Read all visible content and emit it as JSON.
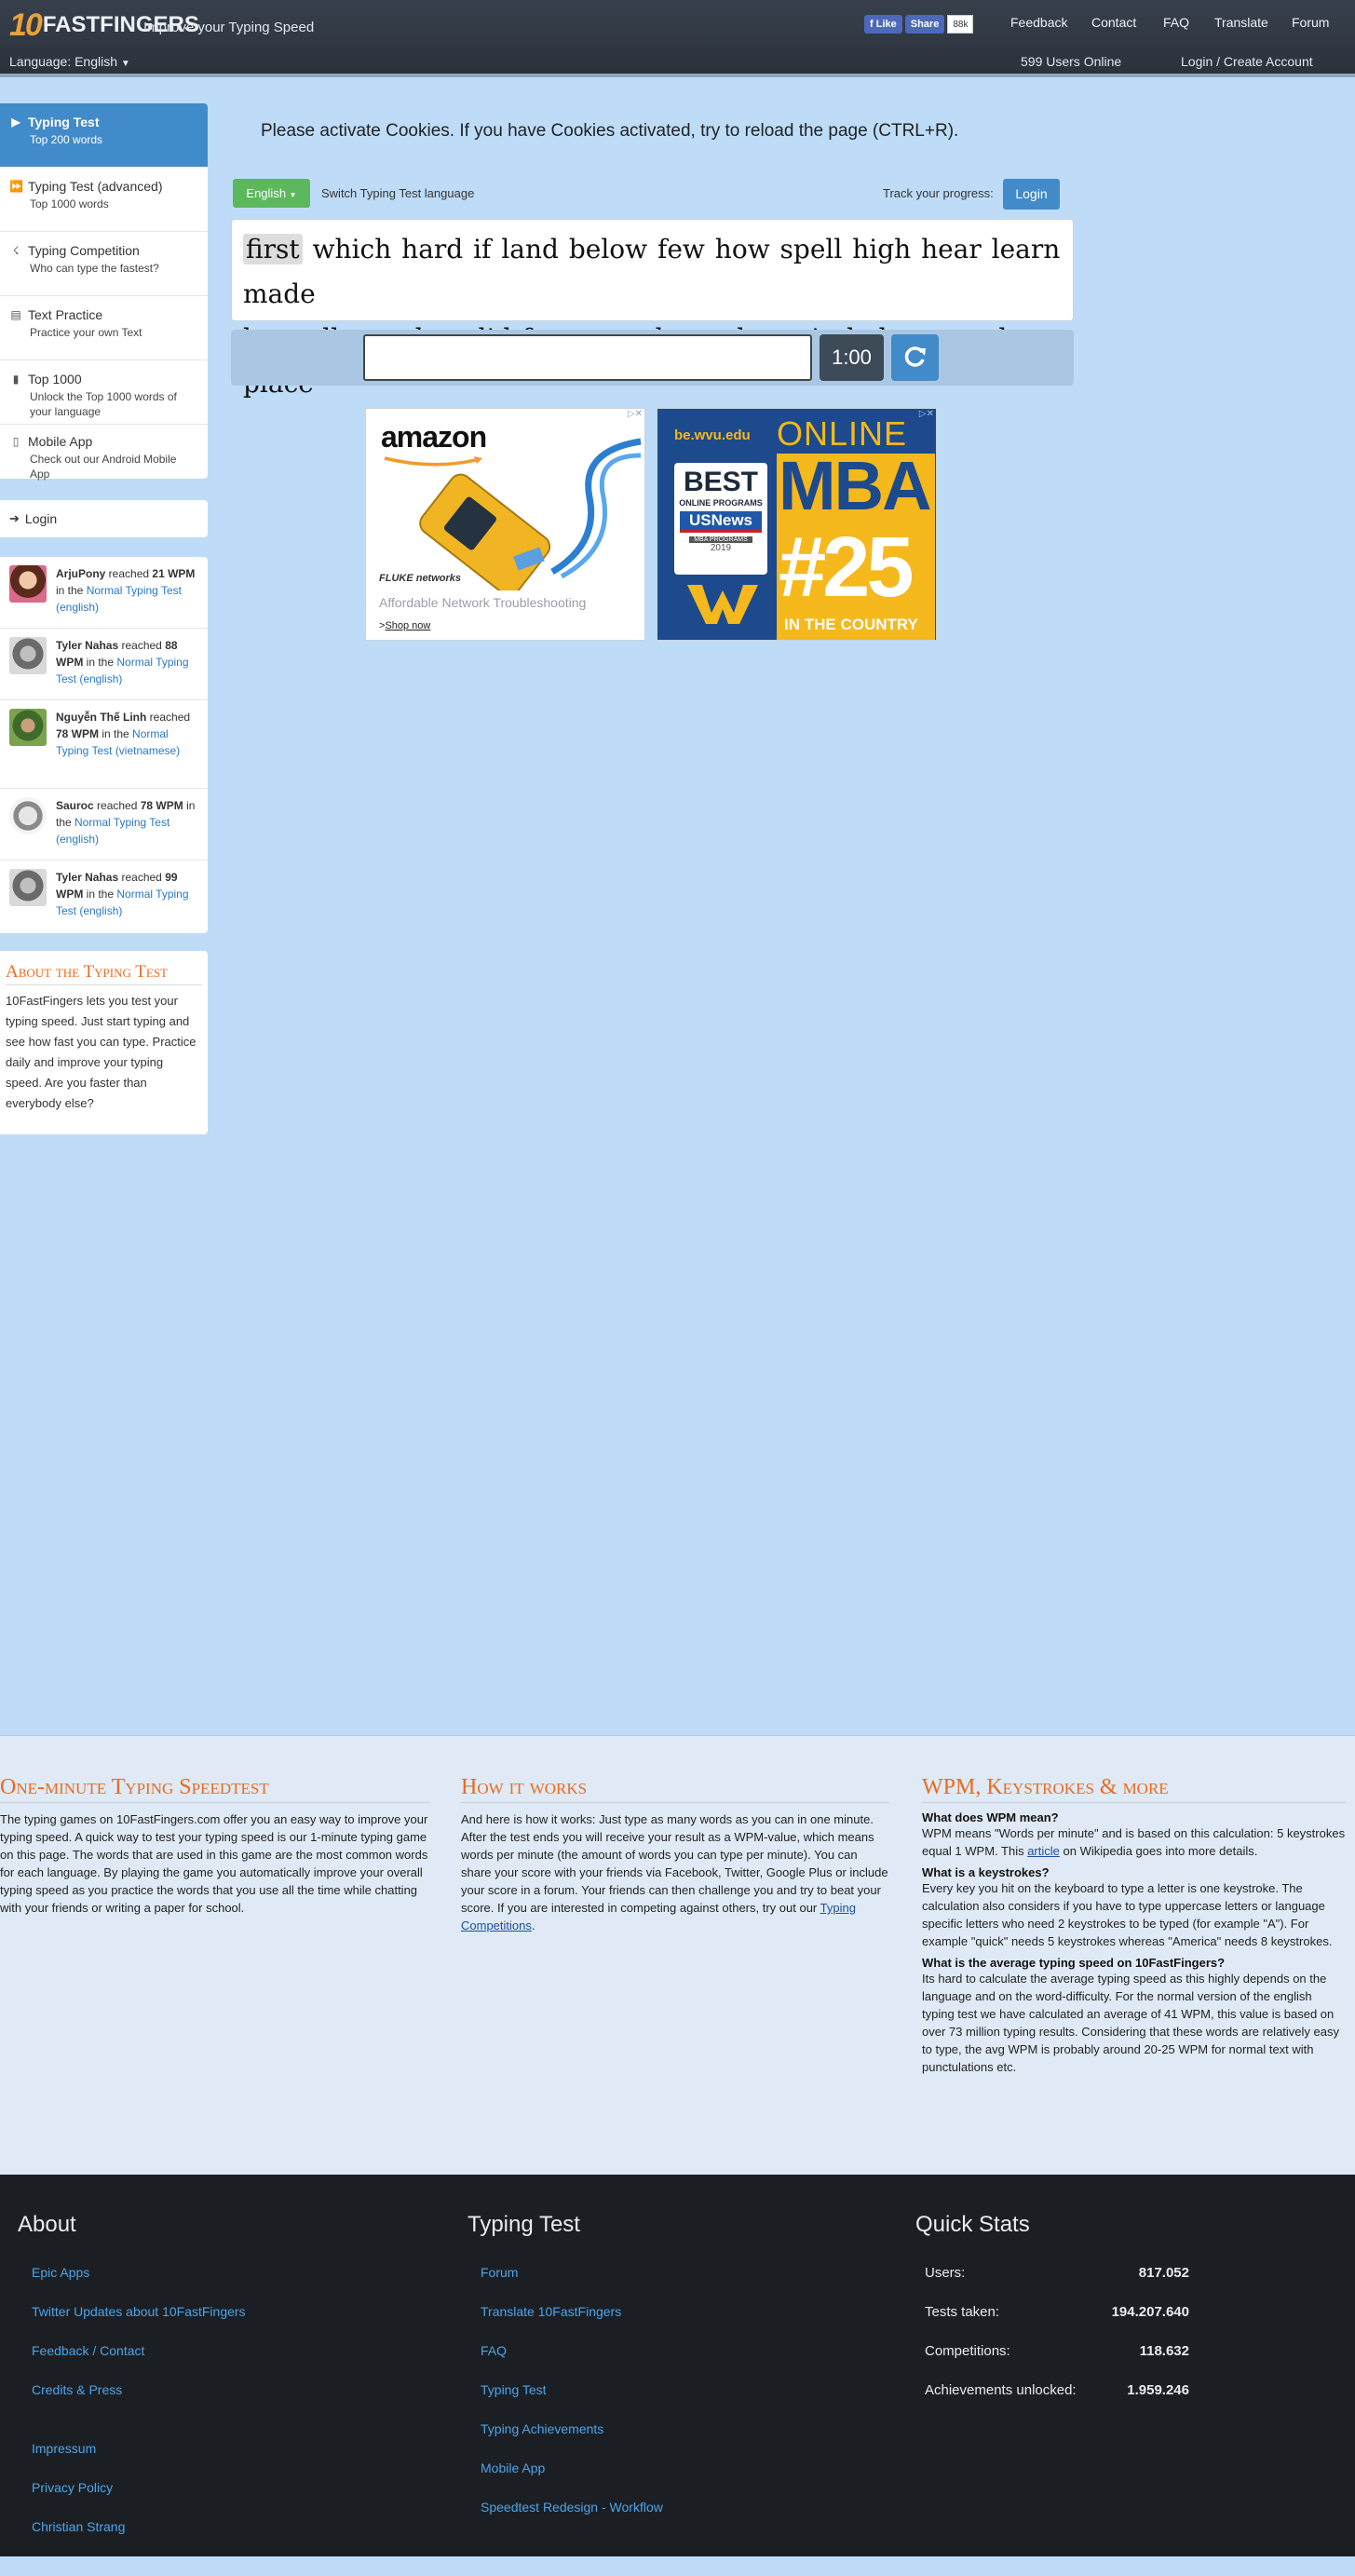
{
  "nav": {
    "logo_ten": "10",
    "logo_text": "FASTFINGERS",
    "tagline": "Improve your Typing Speed",
    "fb_like": "Like",
    "fb_share": "Share",
    "fb_count": "88k",
    "menu": [
      "Feedback",
      "Contact",
      "FAQ",
      "Translate",
      "Forum"
    ],
    "language": "Language: English",
    "users_online": "599 Users Online",
    "login": "Login / Create Account"
  },
  "sidebar": {
    "items": [
      {
        "title": "Typing Test",
        "sub": "Top 200 words",
        "icon": "play-icon"
      },
      {
        "title": "Typing Test (advanced)",
        "sub": "Top 1000 words",
        "icon": "fast-forward-icon"
      },
      {
        "title": "Typing Competition",
        "sub": "Who can type the fastest?",
        "icon": "trophy-icon"
      },
      {
        "title": "Text Practice",
        "sub": "Practice your own Text",
        "icon": "document-icon"
      },
      {
        "title": "Top 1000",
        "sub": "Unlock the Top 1000 words of your language",
        "icon": "signal-icon"
      },
      {
        "title": "Mobile App",
        "sub": "Check out our Android Mobile App",
        "icon": "phone-icon"
      }
    ],
    "login": "Login",
    "feed": [
      {
        "name": "ArjuPony",
        "action": " reached ",
        "wpm": "21 WPM",
        "in": " in the ",
        "test": "Normal Typing Test (english)"
      },
      {
        "name": "Tyler Nahas",
        "action": " reached ",
        "wpm": "88 WPM",
        "in": " in the ",
        "test": "Normal Typing Test (english)"
      },
      {
        "name": "Nguyễn Thế Linh",
        "action": " reached ",
        "wpm": "78 WPM",
        "in": " in the ",
        "test": "Normal Typing Test (vietnamese)"
      },
      {
        "name": "Sauroc",
        "action": " reached ",
        "wpm": "78 WPM",
        "in": " in the ",
        "test": "Normal Typing Test (english)"
      },
      {
        "name": "Tyler Nahas",
        "action": " reached ",
        "wpm": "99 WPM",
        "in": " in the ",
        "test": "Normal Typing Test (english)"
      }
    ],
    "about_title": "About the Typing Test",
    "about_text": "10FastFingers lets you test your typing speed. Just start typing and see how fast you can type. Practice daily and improve your typing speed. Are you faster than everybody else?"
  },
  "main": {
    "cookie_notice": "Please activate Cookies. If you have Cookies activated, try to reload the page (CTRL+R).",
    "language_button": "English",
    "switch_label": "Switch Typing Test language",
    "track_label": "Track your progress:",
    "track_login": "Login",
    "current_word": "first",
    "words_line1": "which hard if land below few how spell high hear learn made",
    "words_line2": "by walk number did far around watch again below car the place",
    "input_value": "",
    "timer": "1:00"
  },
  "ads": {
    "ad1_brand": "amazon",
    "ad1_brand2": "FLUKE networks",
    "ad1_text": "Affordable Network Troubleshooting",
    "ad1_link": "Shop now",
    "ad2_site": "be.wvu.edu",
    "ad2_online": "ONLINE",
    "ad2_mba": "MBA",
    "ad2_best": "BEST",
    "ad2_best_sub": "ONLINE PROGRAMS",
    "ad2_usnews": "USNews",
    "ad2_mba_programs": "MBA PROGRAMS",
    "ad2_year": "2019",
    "ad2_rank": "#25",
    "ad2_country": "IN THE COUNTRY"
  },
  "info": {
    "col1_title": "One-minute Typing Speedtest",
    "col1_text": "The typing games on 10FastFingers.com offer you an easy way to improve your typing speed. A quick way to test your typing speed is our 1-minute typing game on this page. The words that are used in this game are the most common words for each language. By playing the game you automatically improve your overall typing speed as you practice the words that you use all the time while chatting with your friends or writing a paper for school.",
    "col2_title": "How it works",
    "col2_text": "And here is how it works: Just type as many words as you can in one minute. After the test ends you will receive your result as a WPM-value, which means words per minute (the amount of words you can type per minute). You can share your score with your friends via Facebook, Twitter, Google Plus or include your score in a forum. Your friends can then challenge you and try to beat your score. If you are interested in competing against others, try out our ",
    "col2_link": "Typing Competitions",
    "col3_title": "WPM, Keystrokes & more",
    "q1": "What does WPM mean?",
    "a1_pre": "WPM means \"Words per minute\" and is based on this calculation: 5 keystrokes equal 1 WPM. This ",
    "a1_link": "article",
    "a1_post": " on Wikipedia goes into more details.",
    "q2": "What is a keystrokes?",
    "a2": "Every key you hit on the keyboard to type a letter is one keystroke. The calculation also considers if you have to type uppercase letters or language specific letters who need 2 keystrokes to be typed (for example \"A\"). For example \"quick\" needs 5 keystrokes whereas \"America\" needs 8 keystrokes.",
    "q3": "What is the average typing speed on 10FastFingers?",
    "a3": "Its hard to calculate the average typing speed as this highly depends on the language and on the word-difficulty. For the normal version of the english typing test we have calculated an average of 41 WPM, this value is based on over 73 million typing results. Considering that these words are relatively easy to type, the avg WPM is probably around 20-25 WPM for normal text with punctulations etc."
  },
  "footer": {
    "about_title": "About",
    "about_links": [
      "Epic Apps",
      "Twitter Updates about 10FastFingers",
      "Feedback / Contact",
      "Credits & Press",
      "Impressum",
      "Privacy Policy",
      "Christian Strang"
    ],
    "typing_title": "Typing Test",
    "typing_links": [
      "Forum",
      "Translate 10FastFingers",
      "FAQ",
      "Typing Test",
      "Typing Achievements",
      "Mobile App",
      "Speedtest Redesign - Workflow"
    ],
    "stats_title": "Quick Stats",
    "stats": [
      {
        "label": "Users:",
        "value": "817.052"
      },
      {
        "label": "Tests taken:",
        "value": "194.207.640"
      },
      {
        "label": "Competitions:",
        "value": "118.632"
      },
      {
        "label": "Achievements unlocked:",
        "value": "1.959.246"
      }
    ]
  }
}
